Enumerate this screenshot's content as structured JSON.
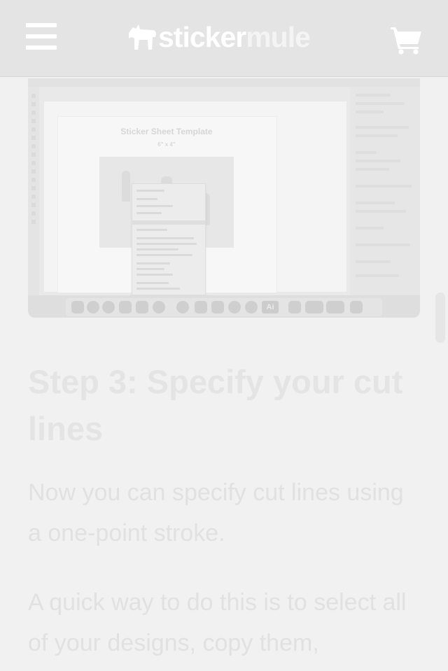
{
  "header": {
    "logo_primary": "sticker",
    "logo_secondary": "mule",
    "menu_icon": "hamburger-menu-icon",
    "cart_icon": "shopping-cart-icon"
  },
  "hero_image": {
    "sheet_title": "Sticker Sheet Template",
    "sheet_subtitle": "6\" x 4\"",
    "dock_ai_label": "Ai"
  },
  "article": {
    "step_title": "Step 3: Specify your cut lines",
    "paragraph_1": "Now you can specify cut lines using a one-point stroke.",
    "paragraph_2": "A quick way to do this is to select all of your designs, copy them,"
  },
  "colors": {
    "header_bg": "#e4e4e4",
    "page_bg": "#f1f1f1",
    "heading_text": "#e4e4e4",
    "body_text": "#e1e1e1"
  }
}
